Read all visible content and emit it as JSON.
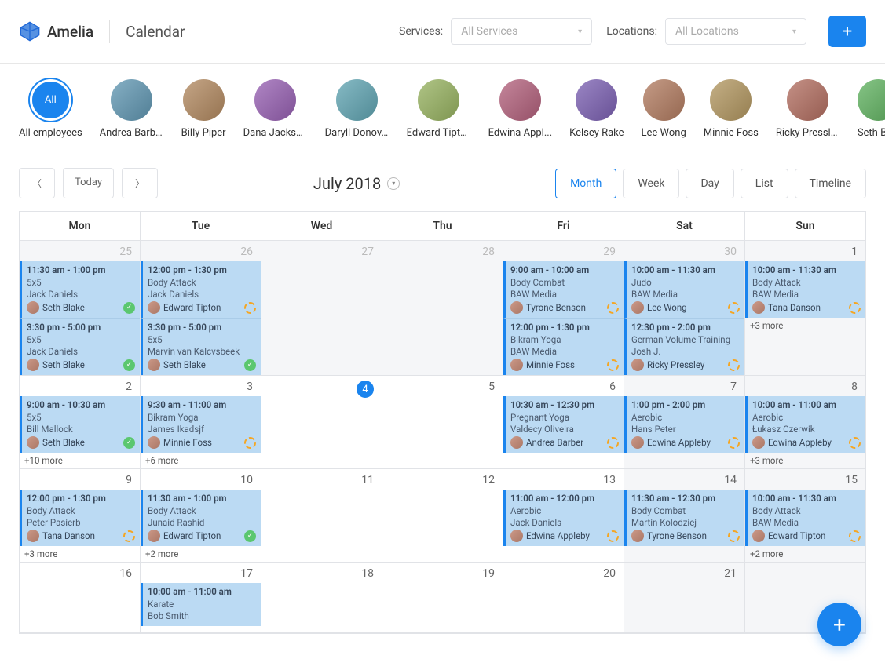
{
  "app": {
    "name": "Amelia",
    "page": "Calendar"
  },
  "filters": {
    "services_label": "Services:",
    "services_placeholder": "All Services",
    "locations_label": "Locations:",
    "locations_placeholder": "All Locations"
  },
  "employees": [
    {
      "name": "All employees",
      "all": true,
      "label": "All"
    },
    {
      "name": "Andrea Barber"
    },
    {
      "name": "Billy Piper"
    },
    {
      "name": "Dana Jackson"
    },
    {
      "name": "Daryll Donov..."
    },
    {
      "name": "Edward Tipton"
    },
    {
      "name": "Edwina Appl..."
    },
    {
      "name": "Kelsey Rake"
    },
    {
      "name": "Lee Wong"
    },
    {
      "name": "Minnie Foss"
    },
    {
      "name": "Ricky Pressley"
    },
    {
      "name": "Seth Blak"
    }
  ],
  "toolbar": {
    "today": "Today",
    "month": "July 2018",
    "views": {
      "month": "Month",
      "week": "Week",
      "day": "Day",
      "list": "List",
      "timeline": "Timeline"
    }
  },
  "day_headers": [
    "Mon",
    "Tue",
    "Wed",
    "Thu",
    "Fri",
    "Sat",
    "Sun"
  ],
  "cells": {
    "r0c0": {
      "date": "25",
      "other": true,
      "events": [
        {
          "time": "11:30 am - 1:00 pm",
          "title": "5x5",
          "sub": "Jack Daniels",
          "emp": "Seth Blake",
          "status": "ok"
        },
        {
          "time": "3:30 pm - 5:00 pm",
          "title": "5x5",
          "sub": "Jack Daniels",
          "emp": "Seth Blake",
          "status": "ok"
        }
      ]
    },
    "r0c1": {
      "date": "26",
      "other": true,
      "events": [
        {
          "time": "12:00 pm - 1:30 pm",
          "title": "Body Attack",
          "sub": "Jack Daniels",
          "emp": "Edward Tipton",
          "status": "repeat"
        },
        {
          "time": "3:30 pm - 5:00 pm",
          "title": "5x5",
          "sub": "Marvin van Kalcvsbeek",
          "emp": "Seth Blake",
          "status": "ok"
        }
      ]
    },
    "r0c2": {
      "date": "27",
      "other": true
    },
    "r0c3": {
      "date": "28",
      "other": true
    },
    "r0c4": {
      "date": "29",
      "other": true,
      "events": [
        {
          "time": "9:00 am - 10:00 am",
          "title": "Body Combat",
          "sub": "BAW Media",
          "emp": "Tyrone Benson",
          "status": "repeat"
        },
        {
          "time": "12:00 pm - 1:30 pm",
          "title": "Bikram Yoga",
          "sub": "BAW Media",
          "emp": "Minnie Foss",
          "status": "repeat"
        }
      ]
    },
    "r0c5": {
      "date": "30",
      "other": true,
      "weekend": true,
      "events": [
        {
          "time": "10:00 am - 11:30 am",
          "title": "Judo",
          "sub": "BAW Media",
          "emp": "Lee Wong",
          "status": "repeat"
        },
        {
          "time": "12:30 pm - 2:00 pm",
          "title": "German Volume Training",
          "sub": "Josh J.",
          "emp": "Ricky Pressley",
          "status": "repeat"
        }
      ]
    },
    "r0c6": {
      "date": "1",
      "weekend": true,
      "events": [
        {
          "time": "10:00 am - 11:30 am",
          "title": "Body Attack",
          "sub": "BAW Media",
          "emp": "Tana Danson",
          "status": "repeat"
        }
      ],
      "more": "+3 more"
    },
    "r1c0": {
      "date": "2",
      "events": [
        {
          "time": "9:00 am - 10:30 am",
          "title": "5x5",
          "sub": "Bill Mallock",
          "emp": "Seth Blake",
          "status": "ok"
        }
      ],
      "more": "+10 more"
    },
    "r1c1": {
      "date": "3",
      "events": [
        {
          "time": "9:30 am - 11:00 am",
          "title": "Bikram Yoga",
          "sub": "James Ikadsjf",
          "emp": "Minnie Foss",
          "status": "repeat"
        }
      ],
      "more": "+6 more"
    },
    "r1c2": {
      "date": "4",
      "today": true
    },
    "r1c3": {
      "date": "5"
    },
    "r1c4": {
      "date": "6",
      "events": [
        {
          "time": "10:30 am - 12:30 pm",
          "title": "Pregnant Yoga",
          "sub": "Valdecy Oliveira",
          "emp": "Andrea Barber",
          "status": "repeat"
        }
      ]
    },
    "r1c5": {
      "date": "7",
      "weekend": true,
      "events": [
        {
          "time": "1:00 pm - 2:00 pm",
          "title": "Aerobic",
          "sub": "Hans Peter",
          "emp": "Edwina Appleby",
          "status": "repeat"
        }
      ]
    },
    "r1c6": {
      "date": "8",
      "weekend": true,
      "events": [
        {
          "time": "10:00 am - 11:00 am",
          "title": "Aerobic",
          "sub": "Łukasz Czerwik",
          "emp": "Edwina Appleby",
          "status": "repeat"
        }
      ],
      "more": "+3 more"
    },
    "r2c0": {
      "date": "9",
      "events": [
        {
          "time": "12:00 pm - 1:30 pm",
          "title": "Body Attack",
          "sub": "Peter Pasierb",
          "emp": "Tana Danson",
          "status": "repeat"
        }
      ],
      "more": "+3 more"
    },
    "r2c1": {
      "date": "10",
      "events": [
        {
          "time": "11:30 am - 1:00 pm",
          "title": "Body Attack",
          "sub": "Junaid Rashid",
          "emp": "Edward Tipton",
          "status": "ok"
        }
      ],
      "more": "+2 more"
    },
    "r2c2": {
      "date": "11"
    },
    "r2c3": {
      "date": "12"
    },
    "r2c4": {
      "date": "13",
      "events": [
        {
          "time": "11:00 am - 12:00 pm",
          "title": "Aerobic",
          "sub": "Jack Daniels",
          "emp": "Edwina Appleby",
          "status": "repeat"
        }
      ]
    },
    "r2c5": {
      "date": "14",
      "weekend": true,
      "events": [
        {
          "time": "11:30 am - 12:30 pm",
          "title": "Body Combat",
          "sub": "Martin Kolodziej",
          "emp": "Tyrone Benson",
          "status": "repeat"
        }
      ]
    },
    "r2c6": {
      "date": "15",
      "weekend": true,
      "events": [
        {
          "time": "10:00 am - 11:30 am",
          "title": "Body Attack",
          "sub": "BAW Media",
          "emp": "Edward Tipton",
          "status": "repeat"
        }
      ],
      "more": "+2 more"
    },
    "r3c0": {
      "date": "16"
    },
    "r3c1": {
      "date": "17",
      "events": [
        {
          "time": "10:00 am - 11:00 am",
          "title": "Karate",
          "sub": "Bob Smith"
        }
      ]
    },
    "r3c2": {
      "date": "18"
    },
    "r3c3": {
      "date": "19"
    },
    "r3c4": {
      "date": "20"
    },
    "r3c5": {
      "date": "21",
      "weekend": true
    },
    "r3c6": {
      "date": "",
      "weekend": true
    }
  }
}
